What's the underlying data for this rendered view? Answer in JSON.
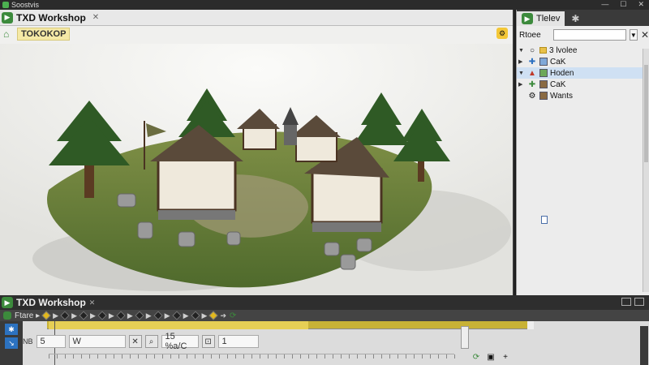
{
  "titlebar": {
    "label": "Soostvis",
    "controls": [
      "—",
      "☐",
      "✕"
    ]
  },
  "viewport": {
    "tab_title": "TXD Workshop",
    "scene_label": "TOKOKOP"
  },
  "right_panel": {
    "tab_label": "Tlelev",
    "header_label": "Rtoee",
    "tree": [
      {
        "label": "3 lvolee",
        "arrow": "▼",
        "icon": "folder",
        "selected": false
      },
      {
        "label": "CaK",
        "arrow": "▶",
        "icon": "box-blue",
        "selected": false
      },
      {
        "label": "Hoden",
        "arrow": "▼",
        "icon": "box-green",
        "selected": true
      },
      {
        "label": "CaK",
        "arrow": "▶",
        "icon": "box-brown",
        "selected": false
      },
      {
        "label": "Wants",
        "arrow": "",
        "icon": "box-brown",
        "selected": false
      }
    ]
  },
  "bottom_panel": {
    "tab_title": "TXD Workshop",
    "toolbar_label": "Ftare ▸",
    "fields": {
      "label_nb": "NB",
      "frame_value": "5",
      "width_label": "W",
      "speed_value": "15 %a/C",
      "count_value": "1"
    }
  },
  "colors": {
    "accent": "#3c8a3c",
    "highlight": "#f5e9a6",
    "selection": "#cfe0f3",
    "timeline": "#c8b236"
  }
}
